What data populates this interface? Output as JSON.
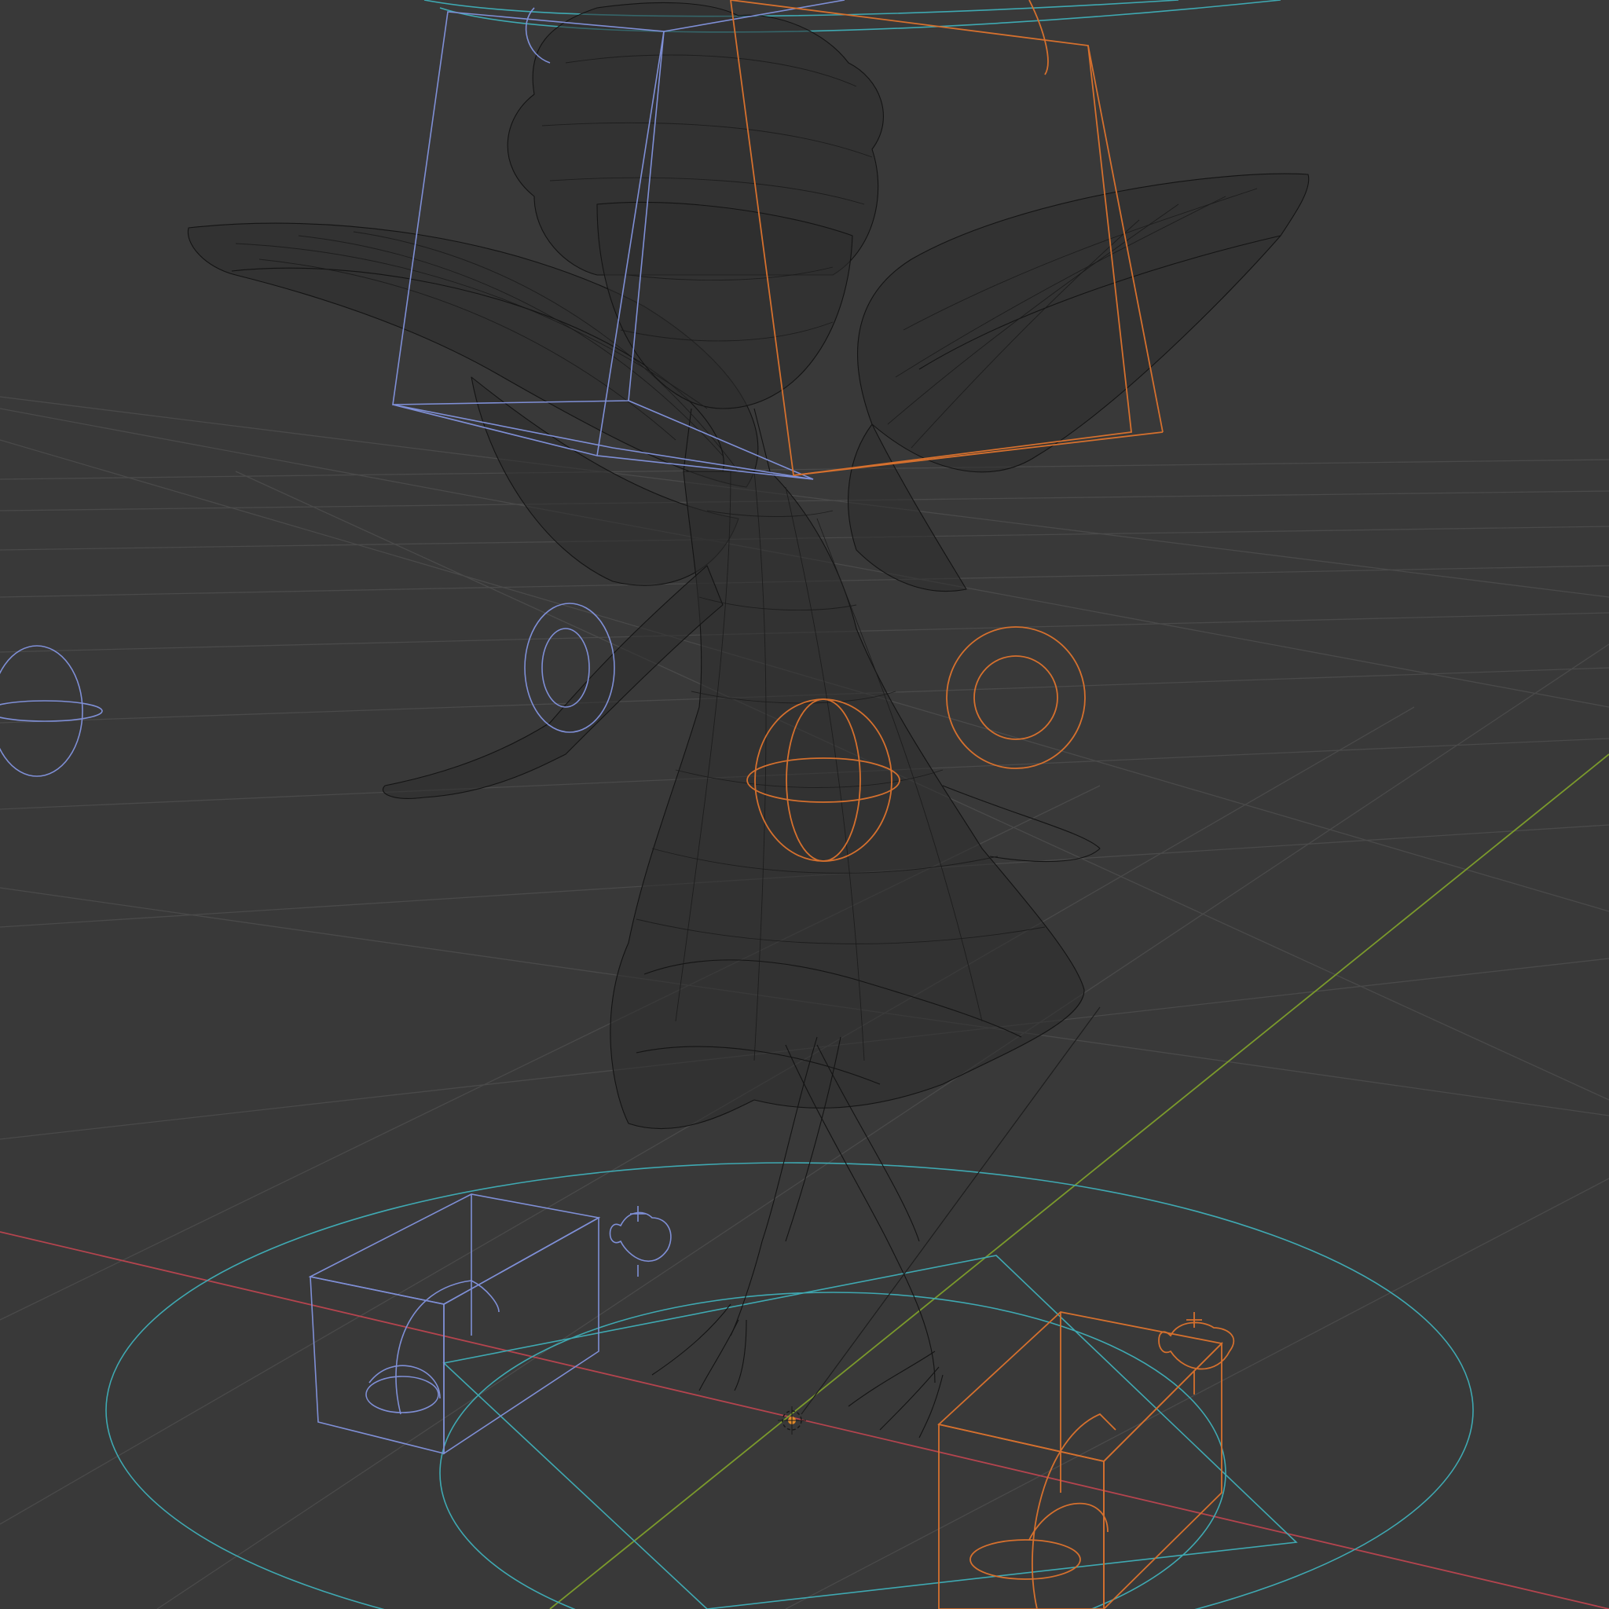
{
  "viewport": {
    "mode": "wireframe",
    "background": "#393939",
    "colors": {
      "grid": "#4a4a4a",
      "x_axis": "#b4444e",
      "y_axis": "#7b9a2c",
      "mesh_wire": "#141414",
      "left_side_controls": "#7f8fd6",
      "right_side_controls": "#d5702e",
      "root_controls": "#3fa9b2"
    },
    "icons": [
      "object-origin-icon",
      "custom-bone-shape-icon"
    ]
  }
}
